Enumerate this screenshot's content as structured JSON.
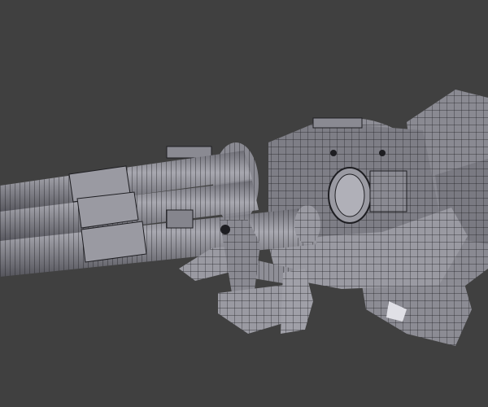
{
  "scene": {
    "subject": "gatling-gun-mesh",
    "view_mode": "wireframe-over-solid",
    "colors": {
      "background": "#404040",
      "mesh_light": "#a4a4ac",
      "mesh_mid": "#85858d",
      "mesh_dark": "#5c5c63",
      "wire": "#1e1e22"
    }
  }
}
